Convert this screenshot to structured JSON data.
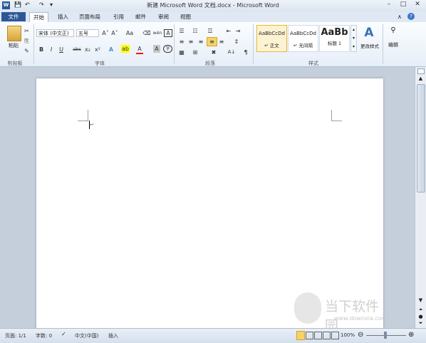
{
  "window": {
    "title": "新建 Microsoft Word 文档.docx - Microsoft Word"
  },
  "qat": {
    "word_logo": "W",
    "save": "💾",
    "undo": "↶",
    "redo": "↷",
    "customize": "▾"
  },
  "window_controls": {
    "minimize": "–",
    "restore": "□",
    "close": "✕"
  },
  "tabs": [
    {
      "label": "文件"
    },
    {
      "label": "开始"
    },
    {
      "label": "插入"
    },
    {
      "label": "页面布局"
    },
    {
      "label": "引用"
    },
    {
      "label": "邮件"
    },
    {
      "label": "审阅"
    },
    {
      "label": "视图"
    }
  ],
  "help_icons": {
    "collapse": "∧",
    "help": "?"
  },
  "ribbon": {
    "clipboard": {
      "group_label": "剪贴板",
      "paste_label": "粘贴",
      "cut": "✂",
      "copy": "⎘",
      "format_painter": "✎"
    },
    "font": {
      "group_label": "字体",
      "font_name": "宋体 (中文正)",
      "font_size": "五号",
      "grow": "A˄",
      "shrink": "A˅",
      "change_case": "Aa",
      "clear": "⌫",
      "phonetic": "wén",
      "border": "A",
      "bold": "B",
      "italic": "I",
      "underline": "U",
      "strike": "abc",
      "subscript": "x₂",
      "superscript": "x²",
      "text_effect": "A",
      "highlight": "ab",
      "font_color": "A",
      "char_shading": "A",
      "enclose": "字"
    },
    "paragraph": {
      "group_label": "段落",
      "bullets": "☰",
      "numbering": "☷",
      "multilevel": "☲",
      "decrease_indent": "⇤",
      "increase_indent": "⇥",
      "chinese_layout": "✖",
      "sort": "A↓",
      "show_marks": "¶",
      "align_left": "≡",
      "center": "≡",
      "align_right": "≡",
      "justify": "≡",
      "distributed": "≡",
      "line_spacing": "↕",
      "shading": "▦",
      "borders": "⊞"
    },
    "styles": {
      "group_label": "样式",
      "items": [
        {
          "preview": "AaBbCcDd",
          "name": "↵ 正文"
        },
        {
          "preview": "AaBbCcDd",
          "name": "↵ 无间隔"
        },
        {
          "preview": "AaBb",
          "name": "标题 1"
        }
      ],
      "change_styles": "更改样式"
    },
    "editing": {
      "label": "编辑"
    }
  },
  "document": {
    "cursor_mark": "↵"
  },
  "status": {
    "page": "页面: 1/1",
    "words": "字数: 0",
    "language": "中文(中国)",
    "insert_mode": "插入",
    "zoom": "100%",
    "zoom_minus": "⊖",
    "zoom_plus": "⊕"
  },
  "watermark": {
    "text": "当下软件园",
    "url": "www.downxia.com"
  },
  "colors": {
    "accent": "#2b5797",
    "tab_bg": "#dfe8f3",
    "doc_bg": "#c5cfdb",
    "highlight": "#ffff00",
    "font_color": "#ff0000"
  }
}
